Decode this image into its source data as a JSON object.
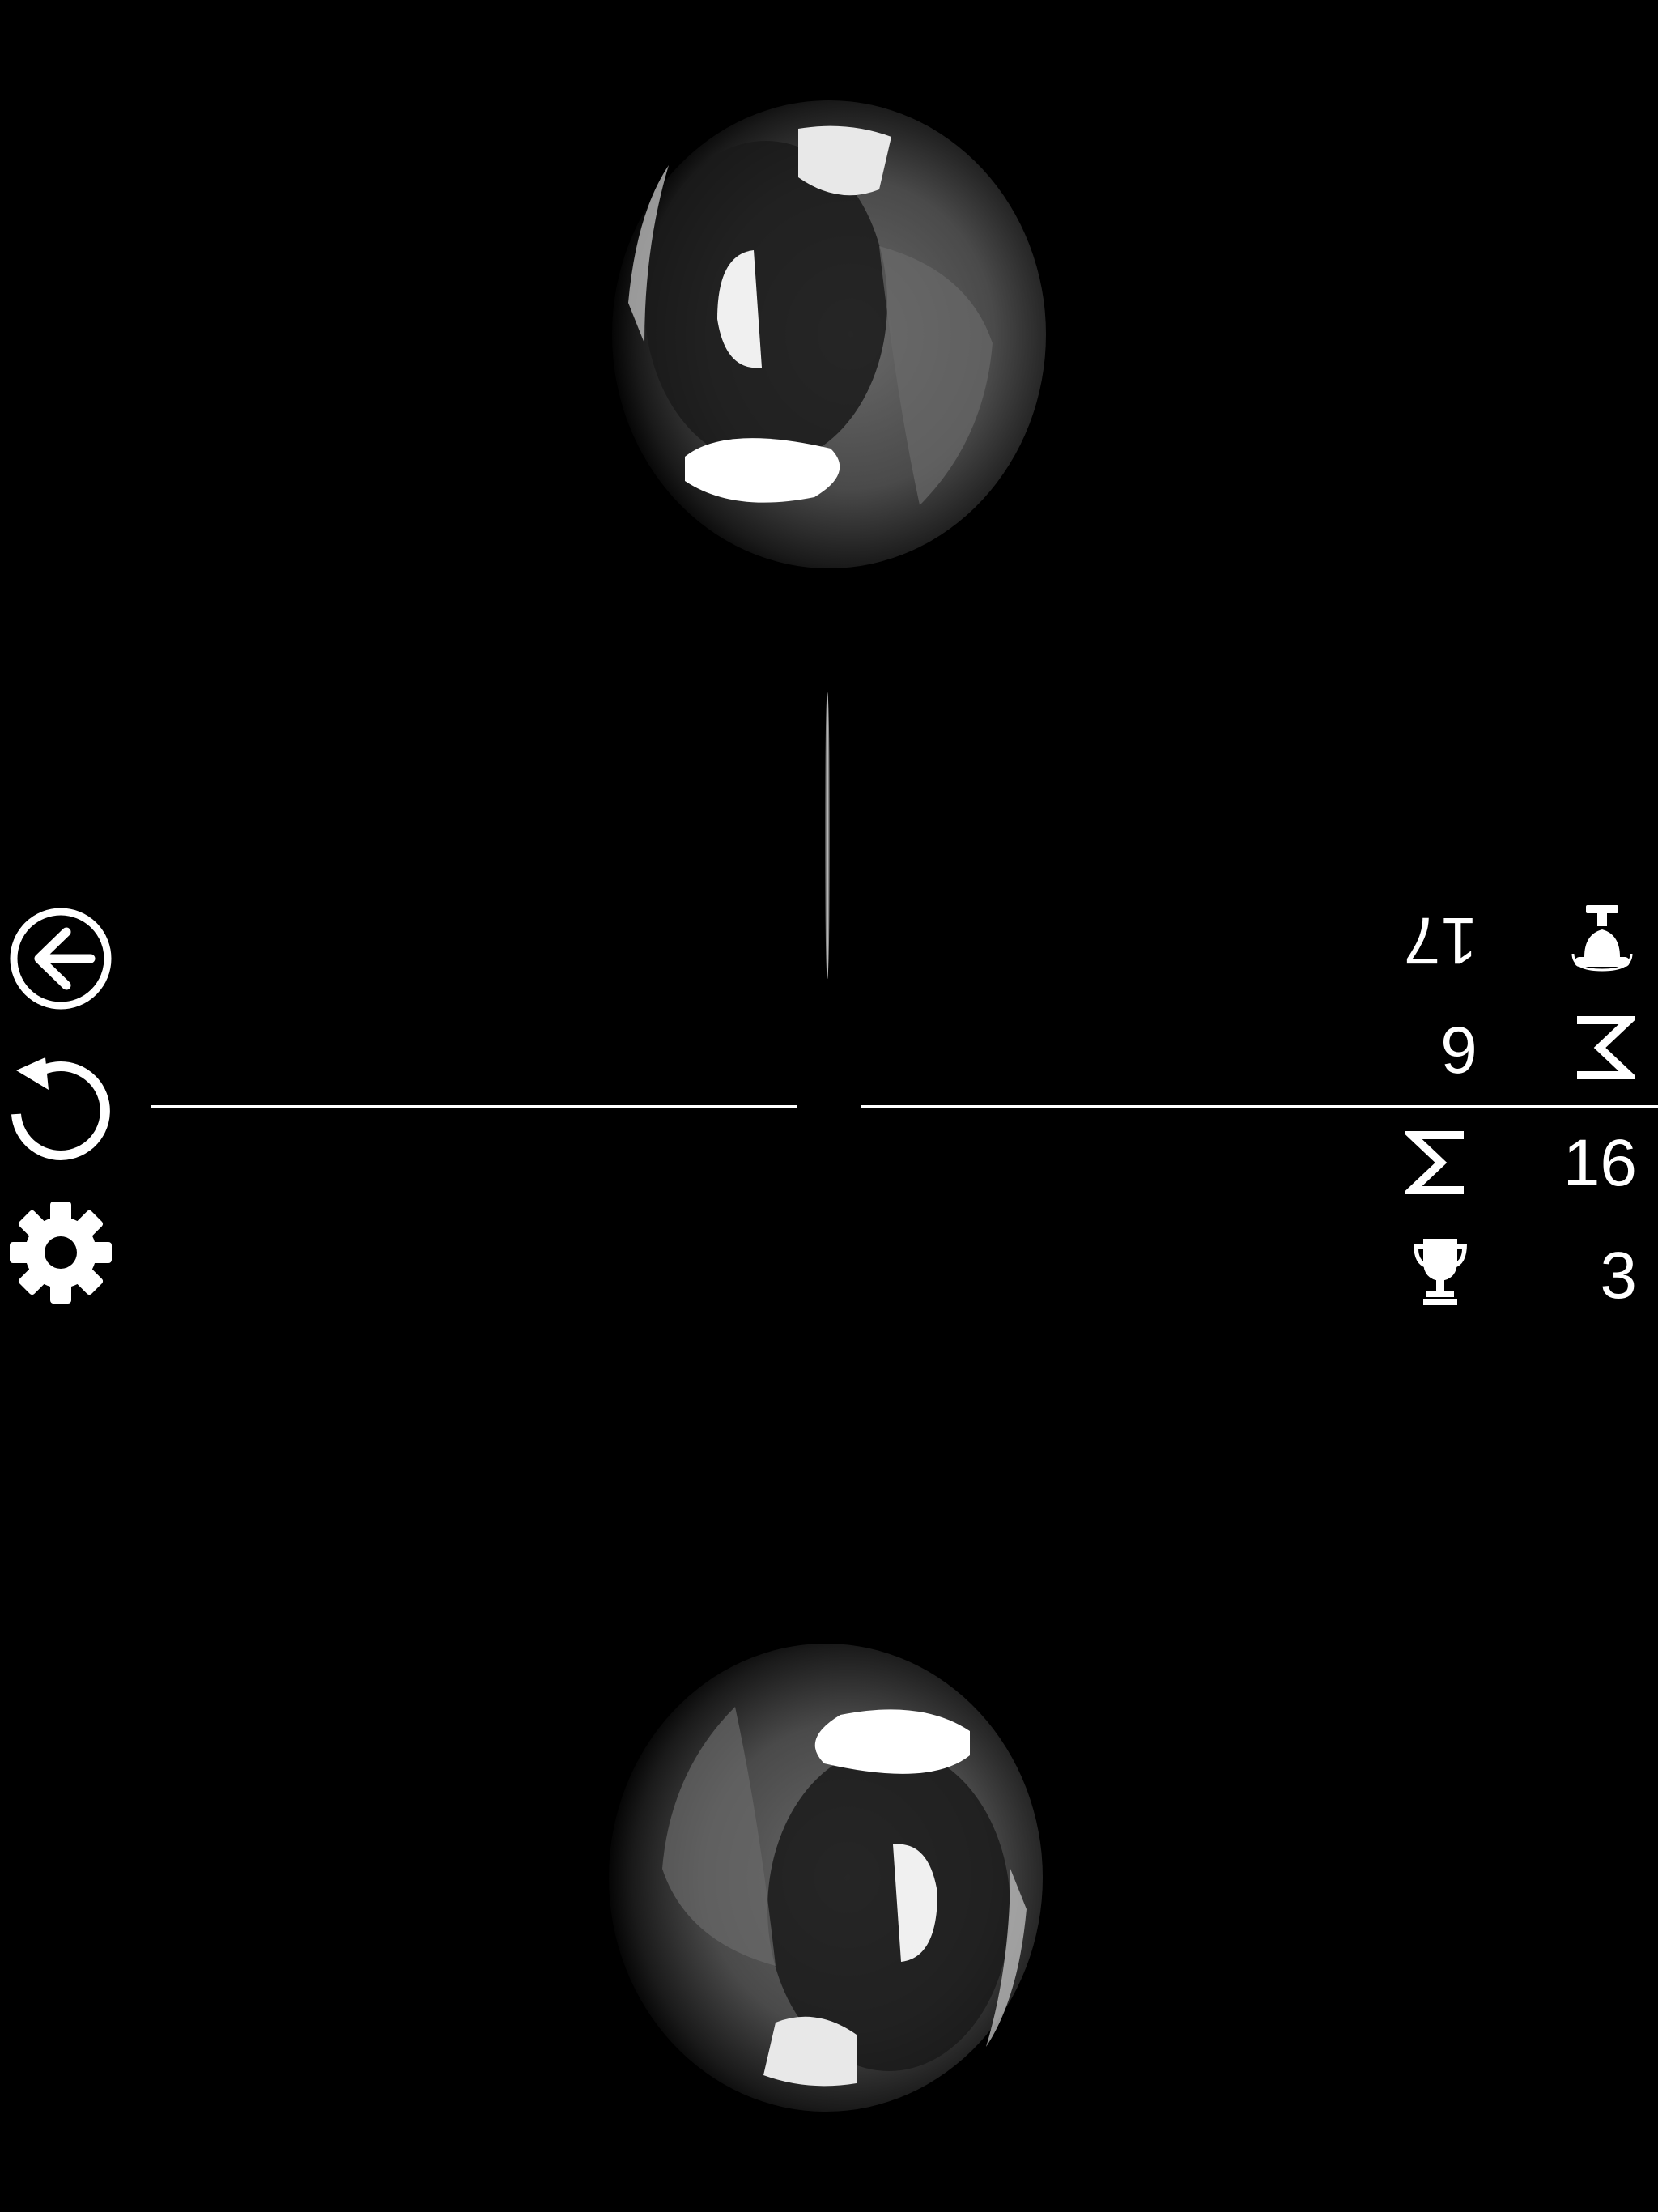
{
  "game": {
    "name": "",
    "colors": {
      "background": "#000000",
      "foreground": "#ffffff",
      "ball_shade": "#5a5a5a"
    }
  },
  "controls": {
    "back": {
      "icon": "arrow-left-circle-icon"
    },
    "restart": {
      "icon": "restart-icon"
    },
    "settings": {
      "icon": "gear-icon"
    }
  },
  "stats": {
    "top_player": {
      "weight_icon": "weight-icon",
      "weight_value": "17",
      "sigma_icon": "sigma-icon",
      "sigma_value": "6"
    },
    "bottom_player": {
      "sigma_icon": "sigma-icon",
      "sigma_value": "16",
      "trophy_icon": "trophy-icon",
      "trophy_value": "3"
    }
  },
  "field": {
    "balls": [
      "ball-top",
      "ball-bottom"
    ],
    "center_line": "center-line",
    "needle": "needle"
  }
}
